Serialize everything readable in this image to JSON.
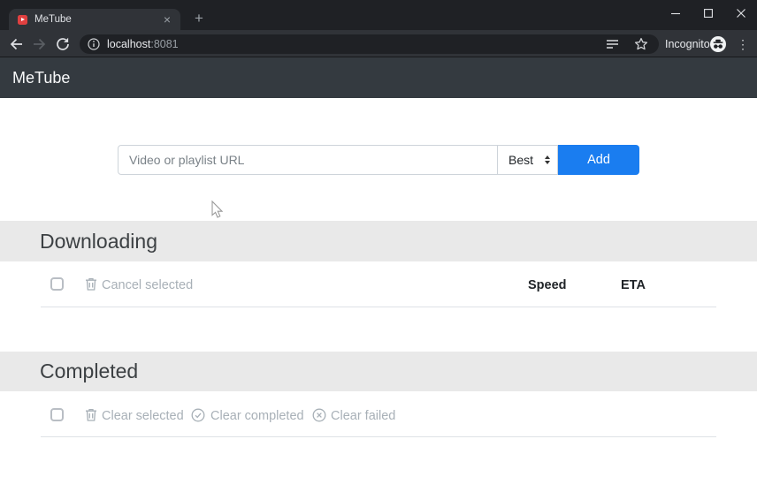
{
  "browser": {
    "tab_title": "MeTube",
    "url": {
      "host": "localhost",
      "port": ":8081"
    },
    "incognito_label": "Incognito"
  },
  "icons": {
    "tab_close": "×",
    "new_tab": "+",
    "menu_overflow": "⋮"
  },
  "app": {
    "brand": "MeTube",
    "form": {
      "url_placeholder": "Video or playlist URL",
      "quality_value": "Best",
      "add_label": "Add"
    },
    "downloading": {
      "title": "Downloading",
      "cancel_label": "Cancel selected",
      "col_speed": "Speed",
      "col_eta": "ETA"
    },
    "completed": {
      "title": "Completed",
      "clear_selected_label": "Clear selected",
      "clear_completed_label": "Clear completed",
      "clear_failed_label": "Clear failed"
    }
  },
  "colors": {
    "accent_blue": "#1a7df0",
    "navbar_dark": "#343a40",
    "section_band": "#e9e9e9",
    "muted_text": "#a8b0b7",
    "favicon_red": "#e04040"
  }
}
